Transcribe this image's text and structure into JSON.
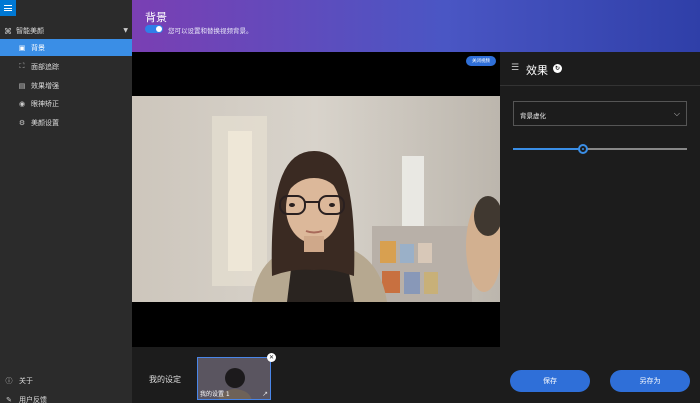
{
  "sidebar": {
    "group": {
      "label": "智能美颜",
      "icon": "palette-icon"
    },
    "items": [
      {
        "label": "背景",
        "icon": "background-icon",
        "active": true
      },
      {
        "label": "面部追踪",
        "icon": "face-tracking-icon",
        "active": false
      },
      {
        "label": "效果增强",
        "icon": "enhance-icon",
        "active": false
      },
      {
        "label": "眼神矫正",
        "icon": "eye-icon",
        "active": false
      },
      {
        "label": "美颜设置",
        "icon": "settings-icon",
        "active": false
      }
    ],
    "footer": [
      {
        "label": "关于",
        "icon": "info-icon"
      },
      {
        "label": "用户反馈",
        "icon": "feedback-icon"
      }
    ]
  },
  "header": {
    "title": "背景",
    "toggle_on": true,
    "description": "您可以设置和替换视频背景。"
  },
  "video": {
    "close_button": "关闭视频"
  },
  "presets": {
    "label": "我的设定",
    "cards": [
      {
        "name": "我的设置 1"
      }
    ]
  },
  "panel": {
    "title": "效果",
    "select_value": "背景虚化",
    "slider_value": 0.4,
    "save_label": "保存",
    "save_as_label": "另存为"
  },
  "colors": {
    "accent": "#3a8ee6",
    "button": "#2f6fd8",
    "header_start": "#7a3fb3",
    "header_end": "#2f3fa8"
  }
}
